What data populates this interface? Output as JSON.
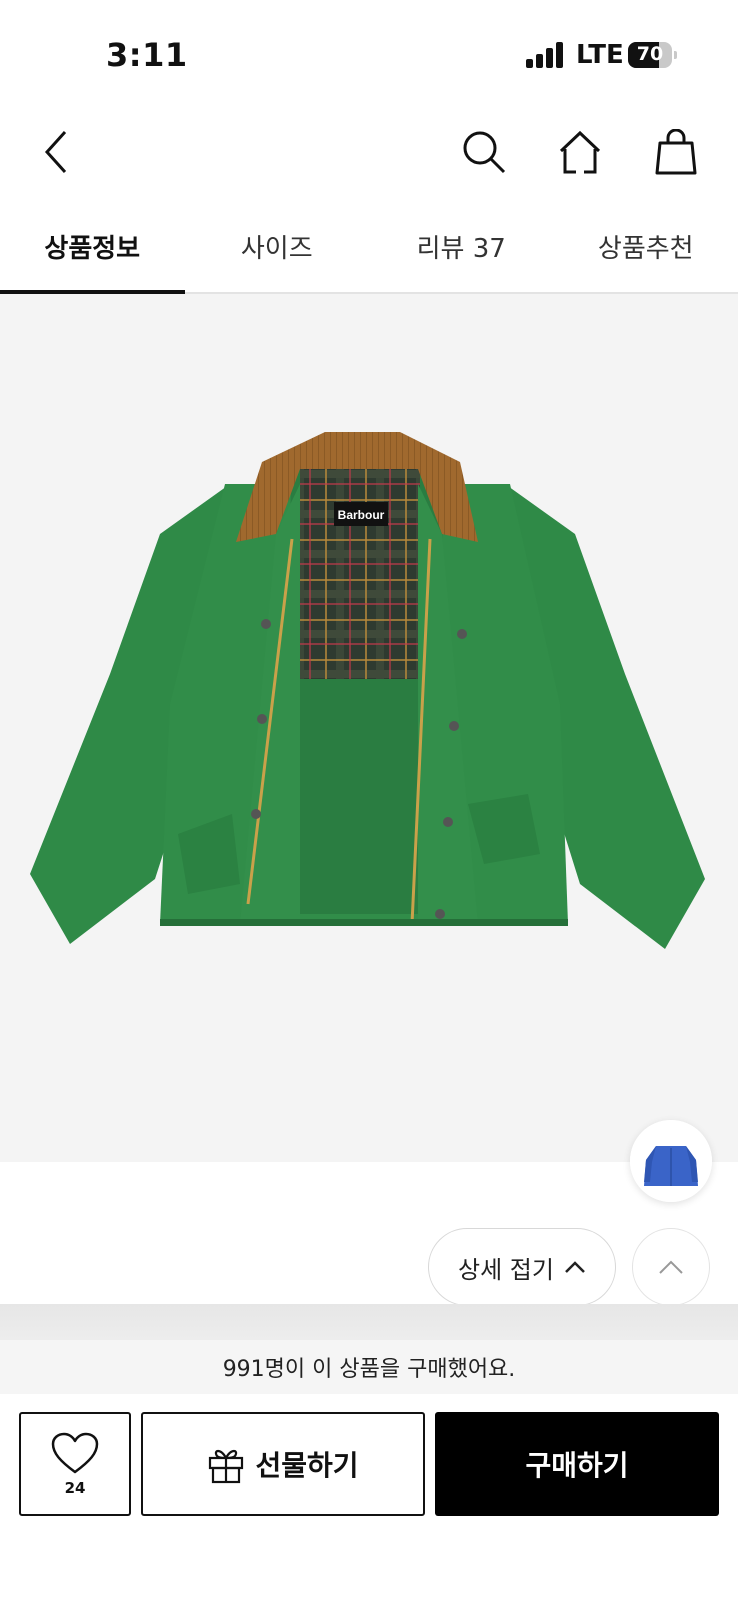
{
  "status_bar": {
    "time": "3:11",
    "network": "LTE",
    "battery_level": "70"
  },
  "nav": {
    "back_icon": "chevron-left-icon",
    "search_icon": "search-icon",
    "home_icon": "home-icon",
    "cart_icon": "shopping-bag-icon"
  },
  "tabs": [
    {
      "label": "상품정보",
      "active": true
    },
    {
      "label": "사이즈",
      "active": false
    },
    {
      "label": "리뷰 37",
      "active": false
    },
    {
      "label": "상품추천",
      "active": false
    }
  ],
  "product": {
    "brand_label": "Barbour",
    "jacket_color": "#2f8a47",
    "collar_color": "#a0692e"
  },
  "detail_toggle": {
    "label": "상세 접기"
  },
  "purchase_banner": {
    "text": "991명이 이 상품을 구매했어요."
  },
  "actions": {
    "like_count": "24",
    "gift_label": "선물하기",
    "buy_label": "구매하기"
  }
}
